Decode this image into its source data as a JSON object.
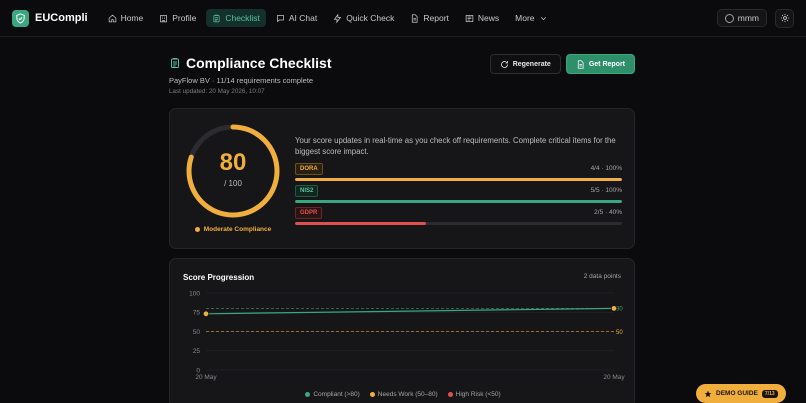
{
  "app": {
    "name": "EUCompli"
  },
  "nav": {
    "items": [
      {
        "label": "Home",
        "icon": "home-icon"
      },
      {
        "label": "Profile",
        "icon": "building-icon"
      },
      {
        "label": "Checklist",
        "icon": "clipboard-icon",
        "active": true
      },
      {
        "label": "AI Chat",
        "icon": "chat-icon"
      },
      {
        "label": "Quick Check",
        "icon": "lightning-icon"
      },
      {
        "label": "Report",
        "icon": "document-icon"
      },
      {
        "label": "News",
        "icon": "newspaper-icon"
      }
    ],
    "more_label": "More",
    "user_label": "mmm"
  },
  "header": {
    "title": "Compliance Checklist",
    "subtitle": "PayFlow BV · 11/14 requirements complete",
    "updated": "Last updated: 20 May 2026, 10:07",
    "regenerate_label": "Regenerate",
    "get_report_label": "Get Report"
  },
  "score": {
    "value": "80",
    "denominator": "/ 100",
    "fraction": 0.8,
    "status": "Moderate Compliance",
    "description": "Your score updates in real-time as you check off requirements. Complete critical items for the biggest score impact.",
    "frameworks": [
      {
        "name": "DORA",
        "stats": "4/4 · 100%",
        "fraction": 1.0,
        "color": "#f0ae3d"
      },
      {
        "name": "NIS2",
        "stats": "5/5 · 100%",
        "fraction": 1.0,
        "color": "#3aa780"
      },
      {
        "name": "GDPR",
        "stats": "2/5 · 40%",
        "fraction": 0.4,
        "color": "#e05050"
      }
    ]
  },
  "progression": {
    "title": "Score Progression",
    "points_label": "2 data points",
    "legend": [
      {
        "label": "Compliant (>80)",
        "color": "#3aa780"
      },
      {
        "label": "Needs Work (50–80)",
        "color": "#f0ae3d"
      },
      {
        "label": "High Risk (<50)",
        "color": "#e05050"
      }
    ]
  },
  "chart_data": {
    "type": "line",
    "title": "Score Progression",
    "x": [
      "20 May",
      "20 May"
    ],
    "series": [
      {
        "values": [
          73,
          80
        ]
      }
    ],
    "ylim": [
      0,
      100
    ],
    "yticks": [
      0,
      25,
      50,
      75,
      100
    ],
    "reference_lines": [
      {
        "value": 80,
        "label": "80",
        "color": "#3aa780"
      },
      {
        "value": 50,
        "label": "50",
        "color": "#f0ae3d"
      }
    ],
    "grid": true
  },
  "demo_guide": {
    "label": "DEMO GUIDE",
    "count": "7/13"
  }
}
